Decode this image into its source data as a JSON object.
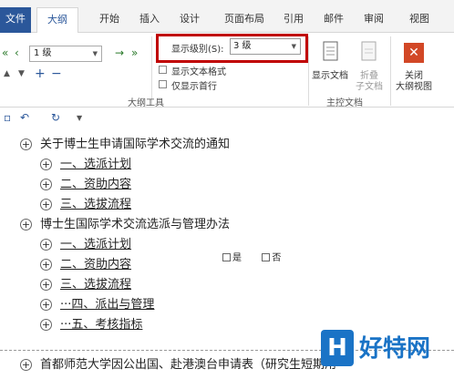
{
  "tabs": [
    {
      "label": "文件"
    },
    {
      "label": "大纲"
    },
    {
      "label": "开始"
    },
    {
      "label": "插入"
    },
    {
      "label": "设计"
    },
    {
      "label": "页面布局"
    },
    {
      "label": "引用"
    },
    {
      "label": "邮件"
    },
    {
      "label": "审阅"
    },
    {
      "label": "视图"
    }
  ],
  "ribbon": {
    "level_value": "1 级",
    "show_level_label": "显示级别(S):",
    "show_level_value": "3 级",
    "show_text_format": "显示文本格式",
    "first_line_only": "仅显示首行",
    "outline_tools": "大纲工具",
    "show_document": "显示文档",
    "collapse_subdoc": "折叠",
    "collapse_subdoc2": "子文档",
    "master_doc": "主控文档",
    "close_outline": "关闭",
    "close_outline2": "大纲视图"
  },
  "document": {
    "items": [
      {
        "text": "关于博士生申请国际学术交流的通知"
      },
      {
        "text": "一、选派计划"
      },
      {
        "text": "二、资助内容"
      },
      {
        "text": "三、选拔流程"
      },
      {
        "text": "博士生国际学术交流选派与管理办法"
      },
      {
        "text": "一、选派计划"
      },
      {
        "text": "二、资助内容"
      },
      {
        "text": "三、选拔流程"
      },
      {
        "text": "···四、派出与管理"
      },
      {
        "text": "···五、考核指标"
      },
      {
        "text": "首都师范大学因公出国、赴港澳台申请表（研究生短期用"
      }
    ],
    "yes": "是",
    "no": "否"
  },
  "watermark": {
    "logo_char": "H",
    "text": "好特网"
  }
}
